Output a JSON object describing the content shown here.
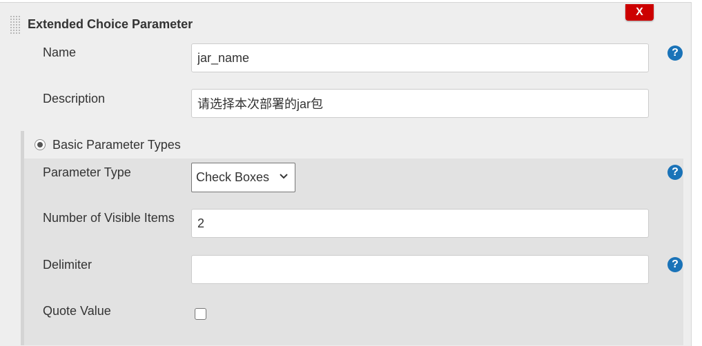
{
  "section": {
    "title": "Extended Choice Parameter",
    "delete_label": "X"
  },
  "fields": {
    "name": {
      "label": "Name",
      "value": "jar_name"
    },
    "description": {
      "label": "Description",
      "value": "请选择本次部署的jar包"
    }
  },
  "basic": {
    "radio_label": "Basic Parameter Types",
    "radio_selected": true,
    "parameter_type": {
      "label": "Parameter Type",
      "selected": "Check Boxes"
    },
    "visible_items": {
      "label": "Number of Visible Items",
      "value": "2"
    },
    "delimiter": {
      "label": "Delimiter",
      "value": ""
    },
    "quote_value": {
      "label": "Quote Value",
      "checked": false
    }
  },
  "help_glyph": "?",
  "colors": {
    "panel_bg": "#eeeeee",
    "sub_bg": "#e2e2e2",
    "delete_red": "#cc0000",
    "help_blue": "#1a73b8"
  }
}
